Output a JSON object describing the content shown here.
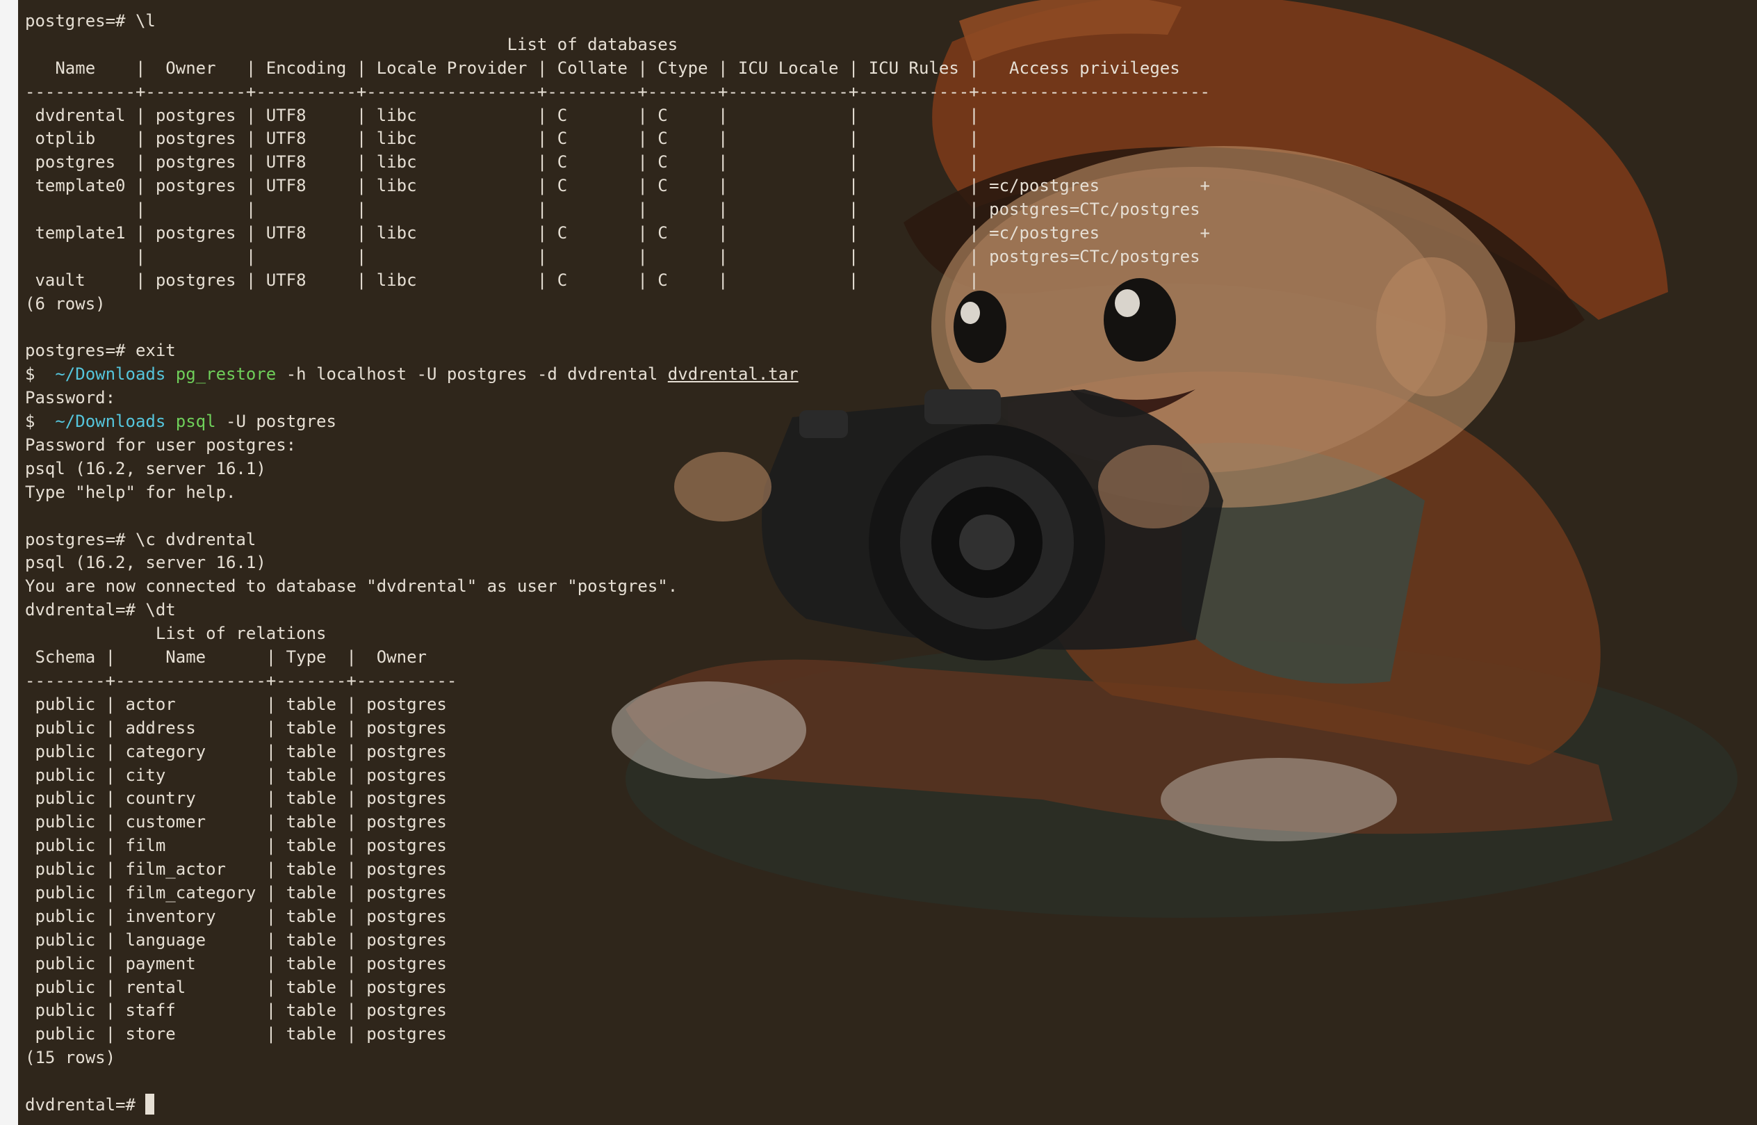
{
  "colors": {
    "background": "#2f261b",
    "text": "#e6dfd4",
    "cwd": "#55c5dc",
    "command": "#6fcf5a"
  },
  "terminal": {
    "lines": [
      "postgres=# \\l",
      "                                                List of databases",
      "   Name    |  Owner   | Encoding | Locale Provider | Collate | Ctype | ICU Locale | ICU Rules |   Access privileges",
      "-----------+----------+----------+-----------------+---------+-------+------------+-----------+-----------------------",
      " dvdrental | postgres | UTF8     | libc            | C       | C     |            |           |",
      " otplib    | postgres | UTF8     | libc            | C       | C     |            |           |",
      " postgres  | postgres | UTF8     | libc            | C       | C     |            |           |",
      " template0 | postgres | UTF8     | libc            | C       | C     |            |           | =c/postgres          +",
      "           |          |          |                 |         |       |            |           | postgres=CTc/postgres",
      " template1 | postgres | UTF8     | libc            | C       | C     |            |           | =c/postgres          +",
      "           |          |          |                 |         |       |            |           | postgres=CTc/postgres",
      " vault     | postgres | UTF8     | libc            | C       | C     |            |           |",
      "(6 rows)",
      "",
      "postgres=# exit"
    ],
    "cmd1": {
      "dollar": "$",
      "cwd": "~/Downloads",
      "program": "pg_restore",
      "args": " -h localhost -U postgres -d dvdrental ",
      "file": "dvdrental.tar"
    },
    "password_line": "Password:",
    "cmd2": {
      "dollar": "$",
      "cwd": "~/Downloads",
      "program": "psql",
      "args": " -U postgres"
    },
    "lines2": [
      "Password for user postgres:",
      "psql (16.2, server 16.1)",
      "Type \"help\" for help.",
      "",
      "postgres=# \\c dvdrental",
      "psql (16.2, server 16.1)",
      "You are now connected to database \"dvdrental\" as user \"postgres\".",
      "dvdrental=# \\dt",
      "             List of relations",
      " Schema |     Name      | Type  |  Owner",
      "--------+---------------+-------+----------",
      " public | actor         | table | postgres",
      " public | address       | table | postgres",
      " public | category      | table | postgres",
      " public | city          | table | postgres",
      " public | country       | table | postgres",
      " public | customer      | table | postgres",
      " public | film          | table | postgres",
      " public | film_actor    | table | postgres",
      " public | film_category | table | postgres",
      " public | inventory     | table | postgres",
      " public | language      | table | postgres",
      " public | payment       | table | postgres",
      " public | rental        | table | postgres",
      " public | staff         | table | postgres",
      " public | store         | table | postgres",
      "(15 rows)",
      ""
    ],
    "final_prompt": "dvdrental=# "
  }
}
